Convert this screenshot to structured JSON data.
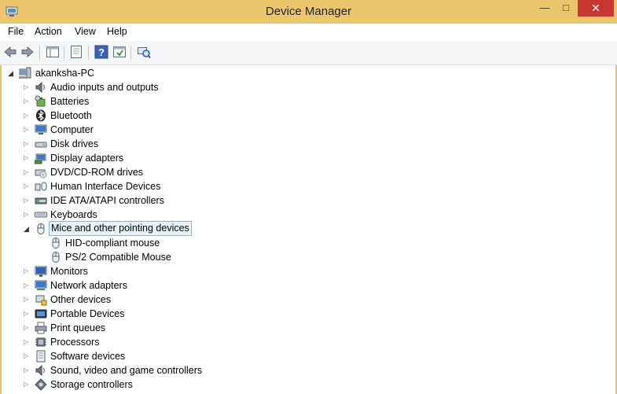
{
  "window": {
    "title": "Device Manager"
  },
  "menu": [
    "File",
    "Action",
    "View",
    "Help"
  ],
  "tree": {
    "root": "akanksha-PC",
    "categories": [
      {
        "label": "Audio inputs and outputs",
        "icon": "speaker-icon"
      },
      {
        "label": "Batteries",
        "icon": "battery-icon"
      },
      {
        "label": "Bluetooth",
        "icon": "bluetooth-icon"
      },
      {
        "label": "Computer",
        "icon": "computer-icon"
      },
      {
        "label": "Disk drives",
        "icon": "disk-drive-icon"
      },
      {
        "label": "Display adapters",
        "icon": "display-adapter-icon"
      },
      {
        "label": "DVD/CD-ROM drives",
        "icon": "dvd-drive-icon"
      },
      {
        "label": "Human Interface Devices",
        "icon": "hid-icon"
      },
      {
        "label": "IDE ATA/ATAPI controllers",
        "icon": "ide-controller-icon"
      },
      {
        "label": "Keyboards",
        "icon": "keyboard-icon"
      },
      {
        "label": "Mice and other pointing devices",
        "icon": "mouse-icon",
        "expanded": true,
        "selected": true,
        "children": [
          {
            "label": "HID-compliant mouse",
            "icon": "mouse-icon"
          },
          {
            "label": "PS/2 Compatible Mouse",
            "icon": "mouse-icon"
          }
        ]
      },
      {
        "label": "Monitors",
        "icon": "monitor-icon"
      },
      {
        "label": "Network adapters",
        "icon": "network-adapter-icon"
      },
      {
        "label": "Other devices",
        "icon": "other-devices-icon"
      },
      {
        "label": "Portable Devices",
        "icon": "portable-device-icon"
      },
      {
        "label": "Print queues",
        "icon": "printer-icon"
      },
      {
        "label": "Processors",
        "icon": "processor-icon"
      },
      {
        "label": "Software devices",
        "icon": "software-device-icon"
      },
      {
        "label": "Sound, video and game controllers",
        "icon": "sound-controller-icon"
      },
      {
        "label": "Storage controllers",
        "icon": "storage-controller-icon"
      }
    ]
  }
}
